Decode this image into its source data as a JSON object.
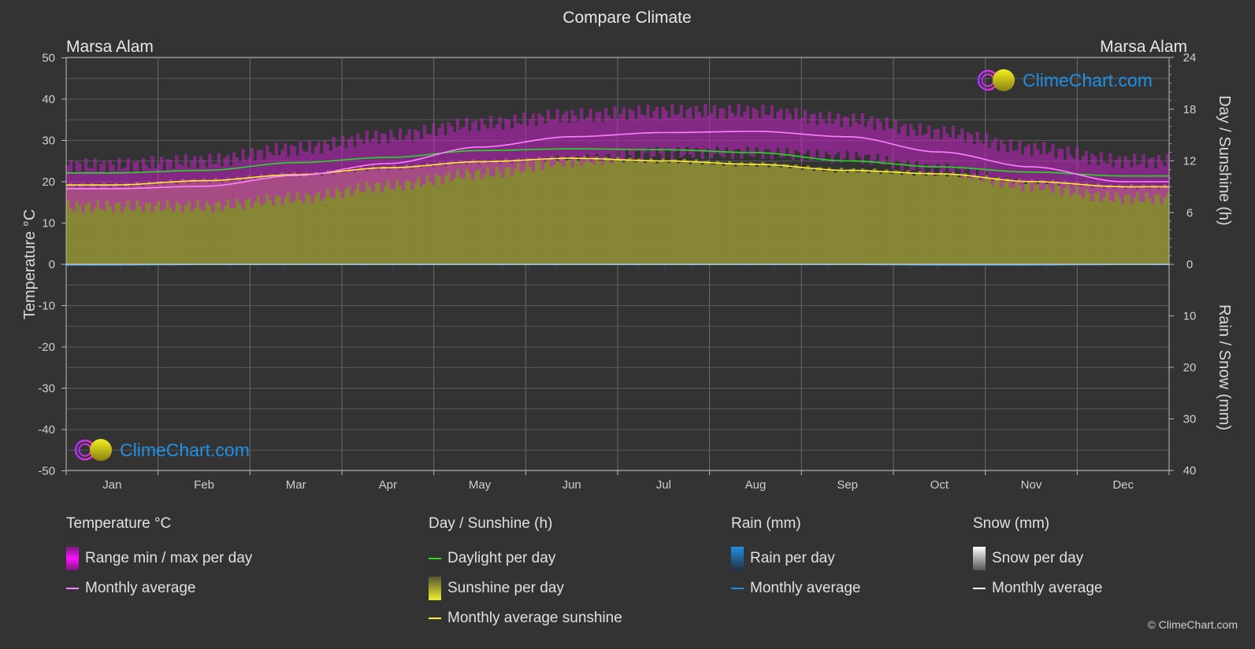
{
  "title": "Compare Climate",
  "location_left": "Marsa Alam",
  "location_right": "Marsa Alam",
  "logo_text": "ClimeChart.com",
  "copyright": "© ClimeChart.com",
  "legend": {
    "temperature": {
      "title": "Temperature °C",
      "items": [
        "Range min / max per day",
        "Monthly average"
      ]
    },
    "sunshine": {
      "title": "Day / Sunshine (h)",
      "items": [
        "Daylight per day",
        "Sunshine per day",
        "Monthly average sunshine"
      ]
    },
    "rain": {
      "title": "Rain (mm)",
      "items": [
        "Rain per day",
        "Monthly average"
      ]
    },
    "snow": {
      "title": "Snow (mm)",
      "items": [
        "Snow per day",
        "Monthly average"
      ]
    }
  },
  "colors": {
    "background": "#333333",
    "temp_range": "#c020c0",
    "temp_avg": "#ff80ff",
    "daylight": "#22dd22",
    "sunshine_fill": "#8a8a36",
    "sunshine_avg": "#ffee33",
    "rain": "#1e8fe6",
    "snow": "#ffffff",
    "logo_blue": "#1e90e6"
  },
  "chart_data": {
    "type": "area",
    "title": "Compare Climate",
    "categories": [
      "Jan",
      "Feb",
      "Mar",
      "Apr",
      "May",
      "Jun",
      "Jul",
      "Aug",
      "Sep",
      "Oct",
      "Nov",
      "Dec"
    ],
    "y_left": {
      "label": "Temperature °C",
      "range": [
        -50,
        50
      ],
      "ticks": [
        50,
        40,
        30,
        20,
        10,
        0,
        -10,
        -20,
        -30,
        -40,
        -50
      ]
    },
    "y_right_top": {
      "label": "Day / Sunshine (h)",
      "range": [
        0,
        24
      ],
      "ticks": [
        24,
        18,
        12,
        6,
        0
      ]
    },
    "y_right_bottom": {
      "label": "Rain / Snow (mm)",
      "range": [
        0,
        40
      ],
      "ticks": [
        0,
        10,
        20,
        30,
        40
      ]
    },
    "grid": true,
    "legend_position": "bottom",
    "series": [
      {
        "name": "Temperature monthly average",
        "unit": "°C",
        "axis": "left",
        "values": [
          18.3,
          18.9,
          21.5,
          24.4,
          28.4,
          30.9,
          31.9,
          32.2,
          30.9,
          27.2,
          23.6,
          20.0
        ]
      },
      {
        "name": "Temperature daily max (approx)",
        "unit": "°C",
        "axis": "left",
        "values": [
          24,
          25,
          28,
          31,
          34,
          36,
          37,
          37,
          35,
          32,
          28,
          25
        ]
      },
      {
        "name": "Temperature daily min (approx)",
        "unit": "°C",
        "axis": "left",
        "values": [
          14,
          14,
          16,
          19,
          22,
          25,
          27,
          27,
          26,
          23,
          19,
          16
        ]
      },
      {
        "name": "Daylight per day",
        "unit": "h",
        "axis": "right_top",
        "values": [
          10.6,
          10.9,
          11.8,
          12.4,
          13.2,
          13.4,
          13.3,
          12.95,
          12.0,
          11.3,
          10.7,
          10.25
        ]
      },
      {
        "name": "Monthly average sunshine",
        "unit": "h",
        "axis": "right_top",
        "values": [
          9.2,
          9.7,
          10.4,
          11.2,
          11.9,
          12.3,
          12.0,
          11.6,
          10.9,
          10.5,
          9.6,
          9.0
        ]
      },
      {
        "name": "Rain monthly average",
        "unit": "mm",
        "axis": "right_bottom",
        "values": [
          0.1,
          0.0,
          0.0,
          0.0,
          0.0,
          0.0,
          0.0,
          0.0,
          0.0,
          0.1,
          0.1,
          0.0
        ]
      },
      {
        "name": "Snow monthly average",
        "unit": "mm",
        "axis": "right_bottom",
        "values": [
          0,
          0,
          0,
          0,
          0,
          0,
          0,
          0,
          0,
          0,
          0,
          0
        ]
      }
    ]
  }
}
